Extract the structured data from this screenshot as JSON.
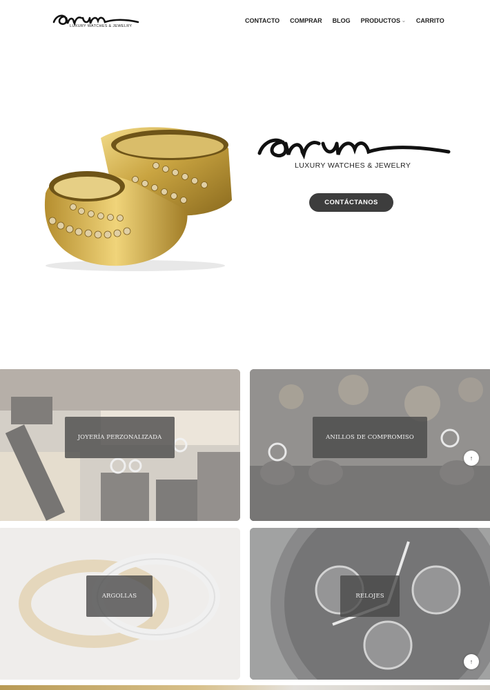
{
  "header": {
    "logo_script": "aurum",
    "logo_tagline": "LUXURY WATCHES & JEWELRY",
    "nav": [
      {
        "label": "CONTACTO"
      },
      {
        "label": "COMPRAR"
      },
      {
        "label": "BLOG"
      },
      {
        "label": "PRODUCTOS",
        "has_dropdown": true
      },
      {
        "label": "CARRITO"
      }
    ]
  },
  "hero": {
    "brand_tagline": "LUXURY WATCHES & JEWELRY",
    "cta_label": "CONTÁCTANOS",
    "image_subject": "gold-rings-icon"
  },
  "categories": [
    {
      "label": "JOYERÍA PERZONALIZADA"
    },
    {
      "label": "ANILLOS DE COMPROMISO"
    },
    {
      "label": "ARGOLLAS"
    },
    {
      "label": "RELOJES"
    }
  ],
  "scroll_top": {
    "icon": "arrow-up-icon",
    "glyph": "↑"
  },
  "colors": {
    "cta_bg": "#3d3d3d",
    "label_bg": "#464646",
    "text": "#222222",
    "gold": "#c9a441"
  }
}
